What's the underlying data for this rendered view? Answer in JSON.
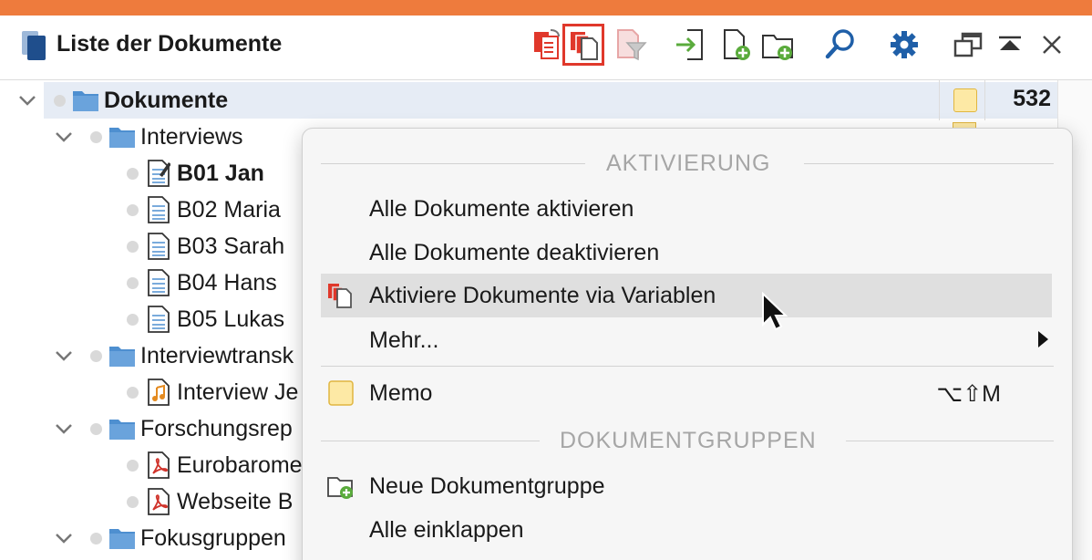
{
  "panel": {
    "title": "Liste der Dokumente"
  },
  "toolbar": [
    {
      "name": "reset-activation-icon"
    },
    {
      "name": "activate-by-variables-icon",
      "selected": true
    },
    {
      "name": "filter-icon"
    },
    {
      "name": "import-icon"
    },
    {
      "name": "new-document-icon"
    },
    {
      "name": "new-document-group-icon"
    },
    {
      "name": "search-icon"
    },
    {
      "name": "gear-icon"
    },
    {
      "name": "undock-window-icon"
    },
    {
      "name": "collapse-panel-icon"
    },
    {
      "name": "close-icon"
    }
  ],
  "tree": {
    "root": {
      "label": "Dokumente",
      "count": "532"
    },
    "rows": [
      {
        "label": "Interviews",
        "type": "folder",
        "level": 1
      },
      {
        "label": "B01 Jan",
        "type": "doc-edit",
        "level": 2,
        "bold": true
      },
      {
        "label": "B02 Maria",
        "type": "doc",
        "level": 2
      },
      {
        "label": "B03 Sarah",
        "type": "doc",
        "level": 2
      },
      {
        "label": "B04 Hans",
        "type": "doc",
        "level": 2
      },
      {
        "label": "B05 Lukas",
        "type": "doc",
        "level": 2
      },
      {
        "label": "Interviewtransk",
        "type": "folder",
        "level": 1
      },
      {
        "label": "Interview Je",
        "type": "audio",
        "level": 2
      },
      {
        "label": "Forschungsrep",
        "type": "folder",
        "level": 1
      },
      {
        "label": "Eurobarome",
        "type": "pdf",
        "level": 2
      },
      {
        "label": "Webseite B",
        "type": "pdf",
        "level": 2
      },
      {
        "label": "Fokusgruppen",
        "type": "folder",
        "level": 1
      }
    ]
  },
  "menu": {
    "section1": "AKTIVIERUNG",
    "items1": [
      {
        "label": "Alle Dokumente aktivieren"
      },
      {
        "label": "Alle Dokumente deaktivieren"
      },
      {
        "label": "Aktiviere Dokumente via Variablen",
        "icon": "activate-by-variables-icon",
        "hover": true
      },
      {
        "label": "Mehr...",
        "submenu": true
      }
    ],
    "memo": {
      "label": "Memo",
      "shortcut": "⌥⇧M"
    },
    "section2": "DOKUMENTGRUPPEN",
    "items2": [
      {
        "label": "Neue Dokumentgruppe",
        "icon": "new-document-group-icon"
      },
      {
        "label": "Alle einklappen"
      }
    ]
  },
  "colors": {
    "accent_bar": "#ee7b3d",
    "folder": "#4e8fd0",
    "selection_red": "#e0382b",
    "memo_yellow": "#fde9a5",
    "plus_green": "#5aab3c"
  }
}
